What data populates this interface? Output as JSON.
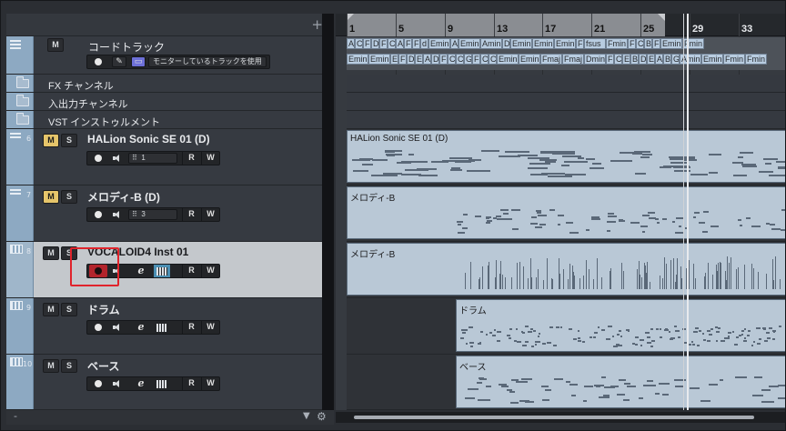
{
  "toolbar": {
    "add_track": "+"
  },
  "ruler": {
    "bars": [
      "1",
      "5",
      "9",
      "13",
      "17",
      "21",
      "25",
      "29",
      "33"
    ]
  },
  "tracks": {
    "chord": {
      "name": "コードトラック",
      "mute_label": "M",
      "monitor_label": "モニターしているトラックを使用"
    },
    "fx": {
      "name": "FX チャンネル"
    },
    "input": {
      "name": "入出力チャンネル"
    },
    "vst": {
      "name": "VST インストゥルメント"
    },
    "halion": {
      "number": "6",
      "name": "HALion Sonic SE 01 (D)",
      "m": "M",
      "s": "S",
      "channel": "1",
      "r": "R",
      "w": "W"
    },
    "melody": {
      "number": "7",
      "name": "メロディ-B (D)",
      "m": "M",
      "s": "S",
      "channel": "3",
      "r": "R",
      "w": "W"
    },
    "vocaloid": {
      "number": "8",
      "name": "VOCALOID4 Inst 01",
      "m": "M",
      "s": "S",
      "e": "e",
      "r": "R",
      "w": "W"
    },
    "drums": {
      "number": "9",
      "name": "ドラム",
      "m": "M",
      "s": "S",
      "e": "e",
      "r": "R",
      "w": "W"
    },
    "bass": {
      "number": "10",
      "name": "ベース",
      "m": "M",
      "s": "S",
      "e": "e",
      "r": "R",
      "w": "W"
    }
  },
  "parts": {
    "halion": "HALion Sonic SE 01 (D)",
    "melody": "メロディ-B",
    "vocaloid": "メロディ-B",
    "drums": "ドラム",
    "bass": "ベース"
  },
  "chords_top": [
    "A",
    "C",
    "F",
    "D",
    "F",
    "C",
    "A",
    "F",
    "F",
    "d",
    "Emin",
    "A",
    "Emin",
    "Amin",
    "D",
    "Emin",
    "Emin",
    "Emin",
    "F",
    "fsus",
    "Fmin",
    "F",
    "C",
    "B",
    "F",
    "Emin",
    "Fmin"
  ],
  "chords_bottom": [
    "Emin",
    "Emin",
    "E",
    "F",
    "D",
    "E",
    "A",
    "D",
    "F",
    "C",
    "C",
    "G",
    "F",
    "C",
    "C",
    "Emin",
    "Emin",
    "Fmaj",
    "Fmaj",
    "Dmin",
    "F",
    "C",
    "E",
    "B",
    "D",
    "E",
    "A",
    "B",
    "G",
    "Amin",
    "Emin",
    "Fmin",
    "Fmin"
  ],
  "bottom": {
    "dash": "-"
  },
  "colors": {
    "record_active": "#b3242c",
    "mute_on": "#e6c56a",
    "highlight": "#e0242c",
    "part": "#b9c8d6",
    "track_color": "#8da9c2"
  }
}
